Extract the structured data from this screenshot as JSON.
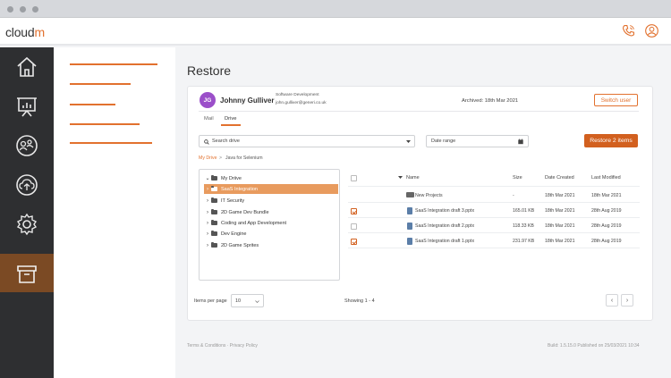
{
  "app": {
    "logo_text": "cloud",
    "logo_accent": "m",
    "accent_color": "#e2712e"
  },
  "page": {
    "title": "Restore"
  },
  "user": {
    "initials": "JG",
    "name": "Johnny Gulliver",
    "department": "Software Development",
    "email": "john.gulliver@generi.co.uk",
    "archived": "Archived: 18th Mar 2021",
    "switch_label": "Switch user"
  },
  "tabs": [
    {
      "label": "Mail"
    },
    {
      "label": "Drive"
    }
  ],
  "search": {
    "placeholder": "Search drive"
  },
  "date_range": {
    "placeholder": "Date range"
  },
  "restore_button": "Restore 2 items",
  "breadcrumb": {
    "root": "My Drive",
    "separator": ">",
    "current": "Java for Selenium"
  },
  "tree": [
    {
      "label": "My Driive",
      "expanded": true
    },
    {
      "label": "SaaS Integration",
      "selected": true
    },
    {
      "label": "IT Security"
    },
    {
      "label": "2D Game Dev Bundle"
    },
    {
      "label": "Coding and App Development"
    },
    {
      "label": "Dev Engine"
    },
    {
      "label": "2D Game Sprites"
    }
  ],
  "table": {
    "columns": [
      "Name",
      "Size",
      "Date Created",
      "Last Modified"
    ],
    "rows": [
      {
        "checked": false,
        "type": "folder",
        "name": "New Projects",
        "size": "-",
        "created": "18th Mar 2021",
        "modified": "18th Mar 2021"
      },
      {
        "checked": true,
        "type": "file",
        "name": "SaaS Integration draft 3.pptx",
        "size": "165.01 KB",
        "created": "18th Mar 2021",
        "modified": "28th Aug 2019"
      },
      {
        "checked": false,
        "type": "file",
        "name": "SaaS Integration draft 2.pptx",
        "size": "118.33 KB",
        "created": "18th Mar 2021",
        "modified": "28th Aug 2019"
      },
      {
        "checked": true,
        "type": "file",
        "name": "SaaS Integration draft 1.pptx",
        "size": "231.97 KB",
        "created": "18th Mar 2021",
        "modified": "28th Aug 2019"
      }
    ]
  },
  "pagination": {
    "items_per_page_label": "Items per page",
    "items_per_page": "10",
    "showing": "Showing 1 - 4",
    "prev": "‹",
    "next": "›"
  },
  "footer": {
    "links": "Terms & Conditions · Privacy Policy",
    "build": "Build: 1.5.15.0 Published on 25/03/2021 10:34"
  }
}
